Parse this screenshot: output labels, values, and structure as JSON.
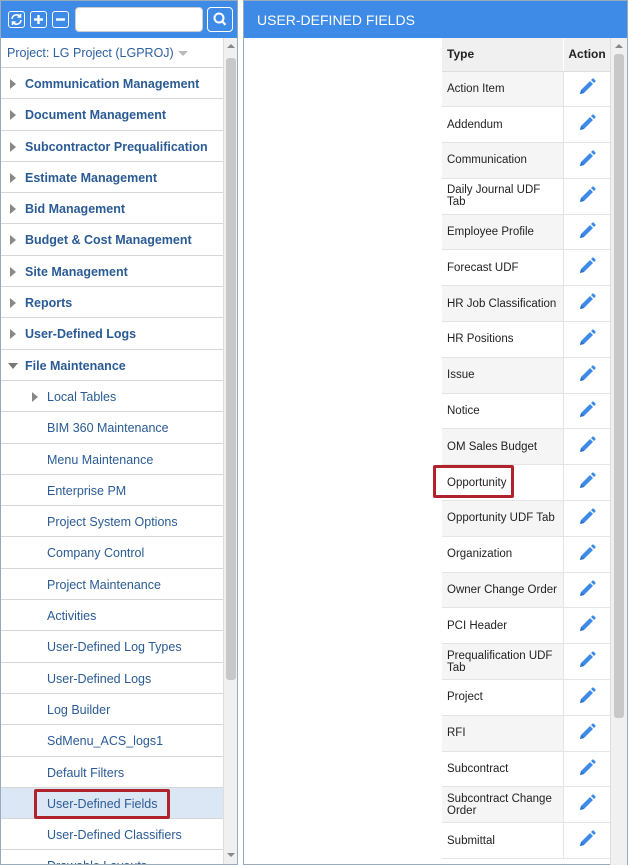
{
  "toolbar": {
    "refresh_icon": "refresh-icon",
    "expand_icon": "plus-icon",
    "collapse_icon": "minus-icon",
    "search_placeholder": "",
    "search_icon": "search-icon"
  },
  "project": {
    "label": "Project: LG Project (LGPROJ)"
  },
  "menu": [
    {
      "label": "Communication Management",
      "level": 0,
      "expanded": false
    },
    {
      "label": "Document Management",
      "level": 0,
      "expanded": false
    },
    {
      "label": "Subcontractor Prequalification",
      "level": 0,
      "expanded": false
    },
    {
      "label": "Estimate Management",
      "level": 0,
      "expanded": false
    },
    {
      "label": "Bid Management",
      "level": 0,
      "expanded": false
    },
    {
      "label": "Budget & Cost Management",
      "level": 0,
      "expanded": false
    },
    {
      "label": "Site Management",
      "level": 0,
      "expanded": false
    },
    {
      "label": "Reports",
      "level": 0,
      "expanded": false
    },
    {
      "label": "User-Defined Logs",
      "level": 0,
      "expanded": false
    },
    {
      "label": "File Maintenance",
      "level": 0,
      "expanded": true
    },
    {
      "label": "Local Tables",
      "level": 1,
      "expandable": true
    },
    {
      "label": "BIM 360 Maintenance",
      "level": 1
    },
    {
      "label": "Menu Maintenance",
      "level": 1
    },
    {
      "label": "Enterprise PM",
      "level": 1
    },
    {
      "label": "Project System Options",
      "level": 1
    },
    {
      "label": "Company Control",
      "level": 1
    },
    {
      "label": "Project Maintenance",
      "level": 1
    },
    {
      "label": "Activities",
      "level": 1
    },
    {
      "label": "User-Defined Log Types",
      "level": 1
    },
    {
      "label": "User-Defined Logs",
      "level": 1
    },
    {
      "label": "Log Builder",
      "level": 1
    },
    {
      "label": "SdMenu_ACS_logs1",
      "level": 1
    },
    {
      "label": "Default Filters",
      "level": 1
    },
    {
      "label": "User-Defined Fields",
      "level": 1,
      "selected": true
    },
    {
      "label": "User-Defined Classifiers",
      "level": 1
    },
    {
      "label": "Drawable Layouts",
      "level": 1
    }
  ],
  "header": {
    "title": "USER-DEFINED FIELDS"
  },
  "table": {
    "columns": [
      "Type",
      "Action"
    ],
    "rows": [
      "Action Item",
      "Addendum",
      "Communication",
      "Daily Journal UDF Tab",
      "Employee Profile",
      "Forecast UDF",
      "HR Job Classification",
      "HR Positions",
      "Issue",
      "Notice",
      "OM Sales Budget",
      "Opportunity",
      "Opportunity UDF Tab",
      "Organization",
      "Owner Change Order",
      "PCI Header",
      "Prequalification UDF Tab",
      "Project",
      "RFI",
      "Subcontract",
      "Subcontract Change Order",
      "Submittal"
    ],
    "action_icon": "pencil-icon",
    "highlighted_row": "Opportunity"
  },
  "colors": {
    "accent": "#3d8be6",
    "highlight": "#b0232a",
    "link": "#2a5b94"
  }
}
